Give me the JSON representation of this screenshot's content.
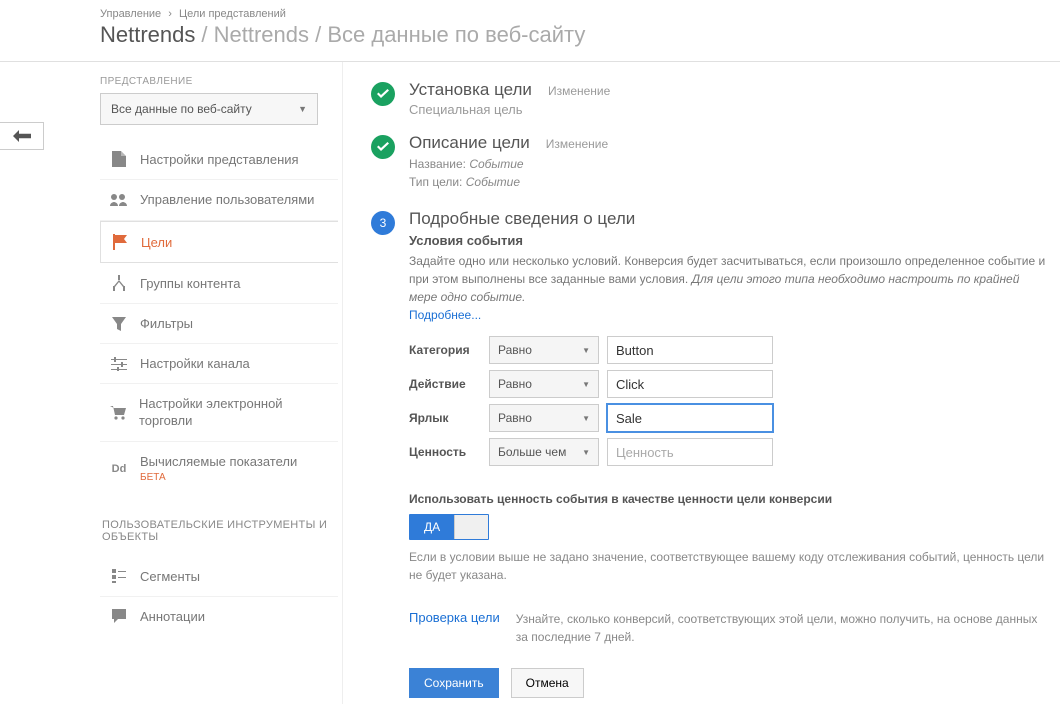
{
  "breadcrumb": {
    "a": "Управление",
    "b": "Цели представлений"
  },
  "page_title": {
    "main": "Nettrends",
    "rest": "/ Nettrends / Все данные по веб-сайту"
  },
  "sidebar": {
    "label": "ПРЕДСТАВЛЕНИЕ",
    "view_select": "Все данные по веб-сайту",
    "items": [
      "Настройки представления",
      "Управление пользователями",
      "Цели",
      "Группы контента",
      "Фильтры",
      "Настройки канала",
      "Настройки электронной торговли",
      "Вычисляемые показатели"
    ],
    "beta": "БЕТА",
    "section2": "ПОЛЬЗОВАТЕЛЬСКИЕ ИНСТРУМЕНТЫ И ОБЪЕКТЫ",
    "sec2_items": [
      "Сегменты",
      "Аннотации"
    ]
  },
  "steps": {
    "edit": "Изменение",
    "s1": {
      "title": "Установка цели",
      "sub": "Специальная цель"
    },
    "s2": {
      "title": "Описание цели",
      "meta_name_label": "Название:",
      "meta_name_val": "Событие",
      "meta_type_label": "Тип цели:",
      "meta_type_val": "Событие"
    },
    "s3": {
      "title": "Подробные сведения о цели",
      "sub": "Условия события",
      "help1": "Задайте одно или несколько условий. Конверсия будет засчитываться, если произошло определенное событие и при этом выполнены все заданные вами условия. ",
      "help_em": "Для цели этого типа необходимо настроить по крайней мере одно событие.",
      "more": "Подробнее...",
      "rows": {
        "r1": {
          "label": "Категория",
          "op": "Равно",
          "val": "Button"
        },
        "r2": {
          "label": "Действие",
          "op": "Равно",
          "val": "Click"
        },
        "r3": {
          "label": "Ярлык",
          "op": "Равно",
          "val": "Sale"
        },
        "r4": {
          "label": "Ценность",
          "op": "Больше чем",
          "placeholder": "Ценность"
        }
      },
      "toggle_title": "Использовать ценность события в качестве ценности цели конверсии",
      "toggle_on": "ДА",
      "toggle_note": "Если в условии выше не задано значение, соответствующее вашему коду отслеживания событий, ценность цели не будет указана.",
      "verify_link": "Проверка цели",
      "verify_desc": "Узнайте, сколько конверсий, соответствующих этой цели, можно получить, на основе данных за последние 7 дней.",
      "save": "Сохранить",
      "cancel": "Отмена"
    }
  },
  "step_num_3": "3"
}
